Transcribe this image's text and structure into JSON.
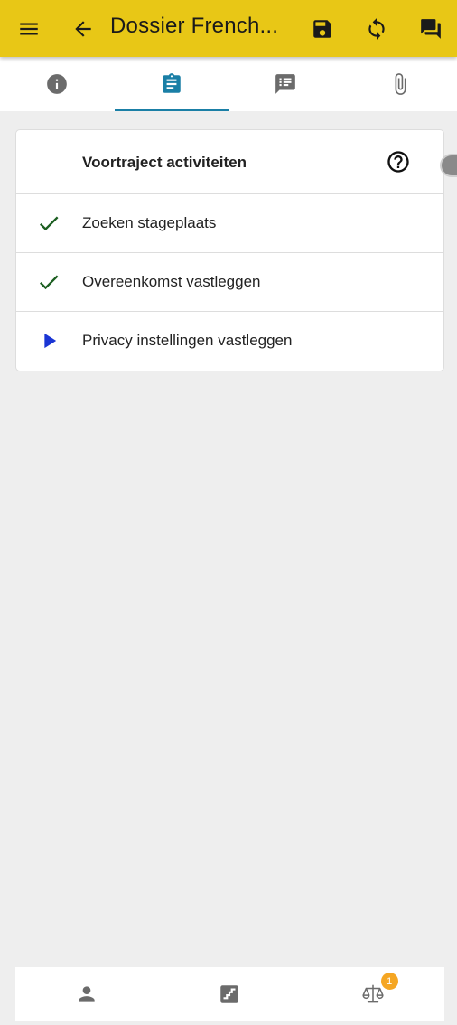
{
  "appbar": {
    "title": "Dossier French...",
    "icons": [
      "menu-icon",
      "arrow-back-icon",
      "save-icon",
      "sync-icon",
      "forum-icon"
    ],
    "background": "#e8c716"
  },
  "tabs": [
    {
      "icon": "info-icon",
      "active": false
    },
    {
      "icon": "assignment-icon",
      "active": true
    },
    {
      "icon": "comment-list-icon",
      "active": false
    },
    {
      "icon": "attachment-icon",
      "active": false
    }
  ],
  "accent": "#1a7fa6",
  "card": {
    "title": "Voortraject activiteiten",
    "help_icon": "help-circle-icon",
    "items": [
      {
        "label": "Zoeken stageplaats",
        "status": "done",
        "icon": "check-icon"
      },
      {
        "label": "Overeenkomst vastleggen",
        "status": "done",
        "icon": "check-icon"
      },
      {
        "label": "Privacy instellingen vastleggen",
        "status": "current",
        "icon": "play-arrow-icon"
      }
    ],
    "status_colors": {
      "done": "#1b5e20",
      "current": "#1a35d4"
    }
  },
  "bottomnav": {
    "items": [
      {
        "icon": "person-icon"
      },
      {
        "icon": "stairs-icon"
      },
      {
        "icon": "balance-scale-icon",
        "badge": "1"
      }
    ],
    "badge_color": "#f5a623"
  }
}
